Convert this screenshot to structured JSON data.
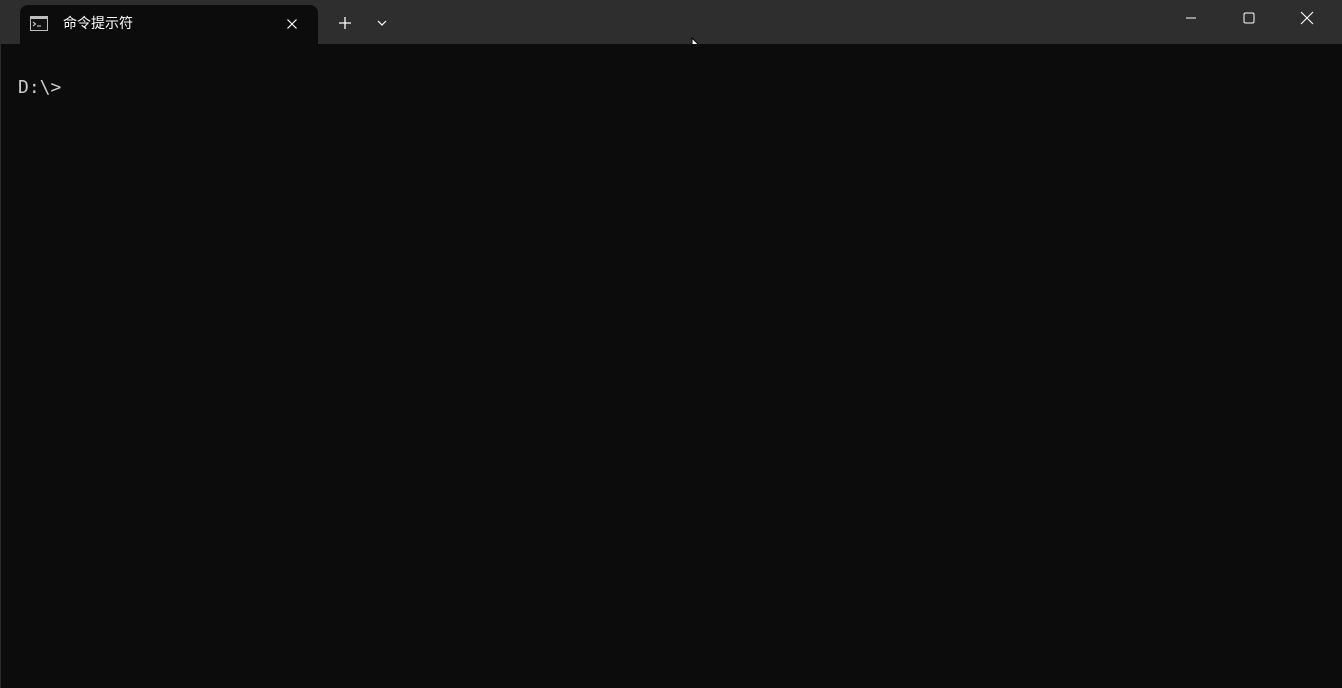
{
  "window": {
    "tab": {
      "title": "命令提示符",
      "icon": "cmd-icon",
      "close_icon": "close-icon"
    },
    "new_tab_icon": "plus-icon",
    "dropdown_icon": "chevron-down-icon",
    "caption": {
      "minimize_icon": "minimize-icon",
      "maximize_icon": "maximize-icon",
      "close_icon": "close-icon"
    }
  },
  "terminal": {
    "prompt": "D:\\>"
  },
  "colors": {
    "titlebar": "#2e2e2e",
    "terminal_bg": "#0c0c0c",
    "terminal_text": "#cccccc",
    "tab_text": "#ffffff"
  }
}
